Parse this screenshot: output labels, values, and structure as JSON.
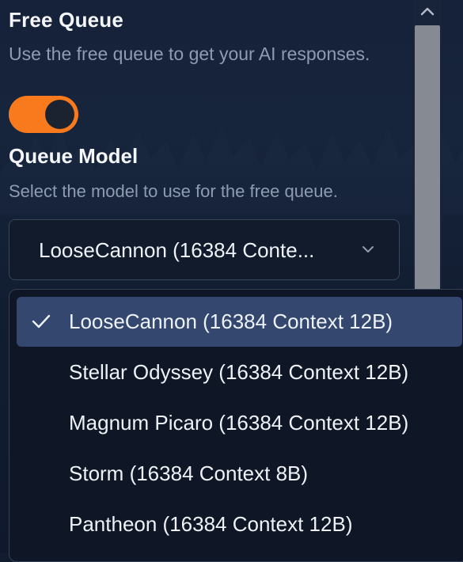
{
  "free_queue": {
    "title": "Free Queue",
    "description": "Use the free queue to get your AI responses.",
    "enabled": true,
    "accent_color": "#f97a1c"
  },
  "queue_model": {
    "title": "Queue Model",
    "description": "Select the model to use for the free queue.",
    "selected_display": "LooseCannon (16384 Conte...",
    "options": [
      {
        "label": "LooseCannon (16384 Context 12B)",
        "selected": true
      },
      {
        "label": "Stellar Odyssey (16384 Context 12B)",
        "selected": false
      },
      {
        "label": "Magnum Picaro (16384 Context 12B)",
        "selected": false
      },
      {
        "label": "Storm (16384 Context 8B)",
        "selected": false
      },
      {
        "label": "Pantheon (16384 Context 12B)",
        "selected": false
      }
    ],
    "selected_color": "#33476f"
  },
  "icons": {
    "check": "check-icon",
    "chevron": "chevron-down-icon",
    "scroll_up": "chevron-up-icon"
  }
}
